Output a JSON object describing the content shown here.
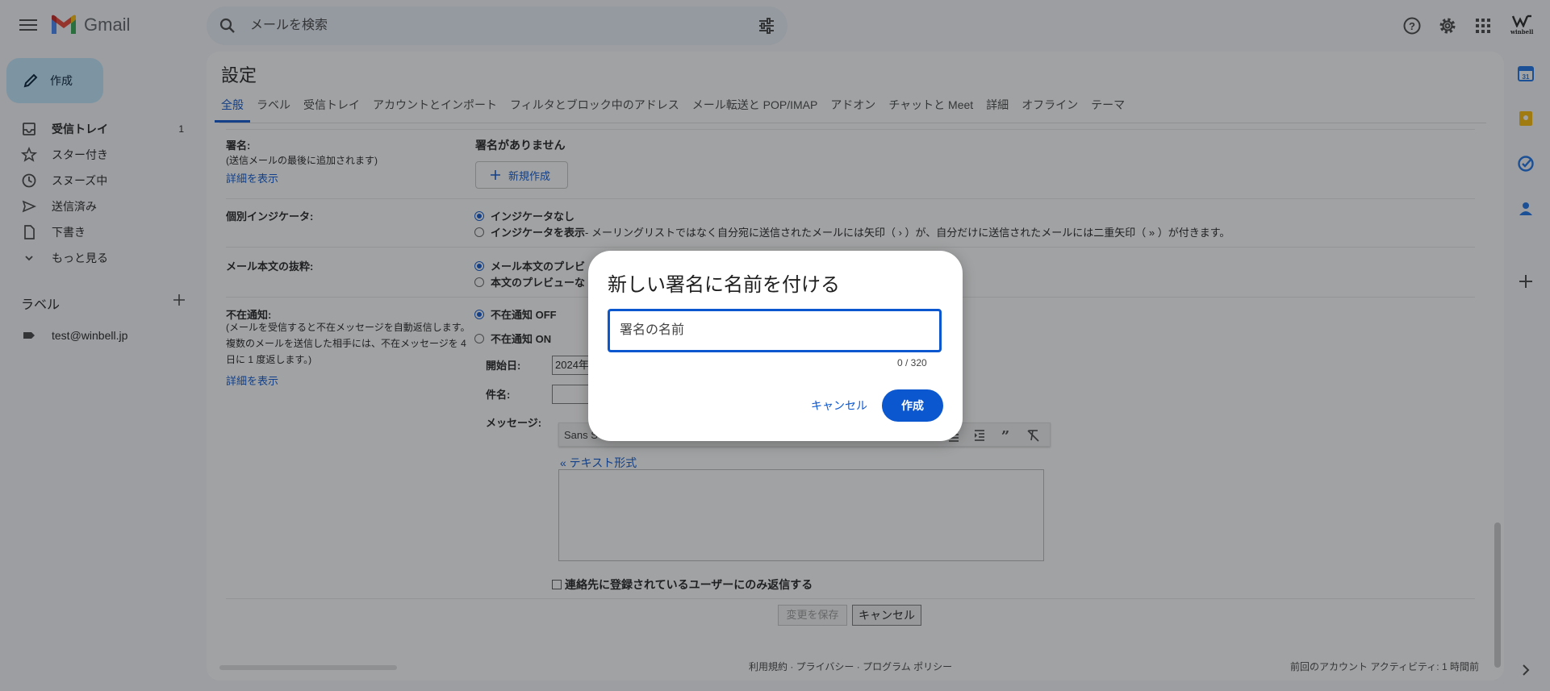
{
  "header": {
    "app_name": "Gmail",
    "search_placeholder": "メールを検索",
    "avatar_text": "winbell"
  },
  "nav": {
    "compose_label": "作成",
    "items": [
      {
        "label": "受信トレイ",
        "count": "1",
        "icon": "inbox-icon"
      },
      {
        "label": "スター付き",
        "icon": "star-icon"
      },
      {
        "label": "スヌーズ中",
        "icon": "clock-icon"
      },
      {
        "label": "送信済み",
        "icon": "send-icon"
      },
      {
        "label": "下書き",
        "icon": "draft-icon"
      },
      {
        "label": "もっと見る",
        "icon": "chevron-down-icon"
      }
    ],
    "labels_heading": "ラベル",
    "labels": [
      {
        "label": "test@winbell.jp",
        "icon": "label-icon"
      }
    ]
  },
  "settings": {
    "title": "設定",
    "tabs": [
      "全般",
      "ラベル",
      "受信トレイ",
      "アカウントとインポート",
      "フィルタとブロック中のアドレス",
      "メール転送と POP/IMAP",
      "アドオン",
      "チャットと Meet",
      "詳細",
      "オフライン",
      "テーマ"
    ],
    "signature": {
      "label": "署名:",
      "sub": "(送信メールの最後に追加されます)",
      "link": "詳細を表示",
      "none": "署名がありません",
      "new_button": "新規作成"
    },
    "indicator": {
      "label": "個別インジケータ:",
      "opt1": "インジケータなし",
      "opt2_bold": "インジケータを表示",
      "opt2_desc": " - メーリングリストではなく自分宛に送信されたメールには矢印（ › ）が、自分だけに送信されたメールには二重矢印（ » ）が付きます。"
    },
    "snippets": {
      "label": "メール本文の抜粋:",
      "opt1": "メール本文のプレビ",
      "opt2": "本文のプレビューな"
    },
    "vacation": {
      "label": "不在通知:",
      "sub1": "(メールを受信すると不在メッセージを自動返信します。",
      "sub2": "複数のメールを送信した相手には、不在メッセージを 4",
      "sub3": "日に 1 度返します。)",
      "link": "詳細を表示",
      "off": "不在通知 OFF",
      "on": "不在通知 ON",
      "start_label": "開始日:",
      "start_value": "2024年",
      "subject_label": "件名:",
      "message_label": "メッセージ:",
      "font": "Sans S",
      "text_mode": "« テキスト形式",
      "contacts_only": "連絡先に登録されているユーザーにのみ返信する"
    },
    "save_button": "変更を保存",
    "cancel_button": "キャンセル",
    "footer_links": "利用規約 · プライバシー · プログラム ポリシー",
    "footer_activity": "前回のアカウント アクティビティ: 1 時間前"
  },
  "dialog": {
    "title": "新しい署名に名前を付ける",
    "input_placeholder": "署名の名前",
    "counter": "0 / 320",
    "cancel": "キャンセル",
    "create": "作成"
  },
  "colors": {
    "accent": "#0b57d0",
    "compose_bg": "#c2e7ff",
    "page_bg": "#f6f8fc"
  }
}
